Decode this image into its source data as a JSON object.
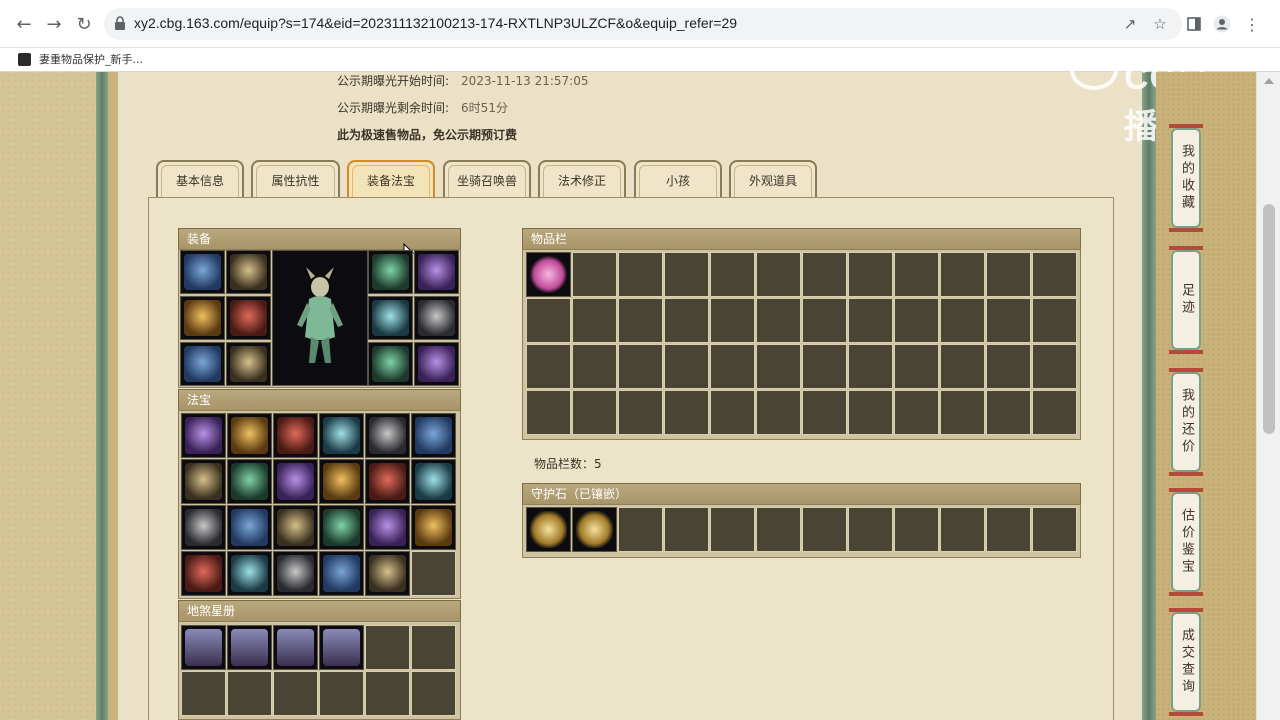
{
  "browser": {
    "url": "xy2.cbg.163.com/equip?s=174&eid=202311132100213-174-RXTLNP3ULZCF&o&equip_refer=29",
    "bookmark_label": "妻重物品保护_新手..."
  },
  "watermark": {
    "text": "CC直播"
  },
  "info": {
    "publicity_start_label": "公示期曝光开始时间:",
    "publicity_start_value": "2023-11-13 21:57:05",
    "publicity_remaining_label": "公示期曝光剩余时间:",
    "publicity_remaining_value": "6时51分",
    "notice": "此为极速售物品，免公示期预订费"
  },
  "tabs": [
    {
      "label": "基本信息"
    },
    {
      "label": "属性抗性"
    },
    {
      "label": "装备法宝",
      "active": true
    },
    {
      "label": "坐骑召唤兽"
    },
    {
      "label": "法术修正"
    },
    {
      "label": "小孩"
    },
    {
      "label": "外观道具"
    }
  ],
  "sections": {
    "equipment": "装备",
    "treasure": "法宝",
    "star_book": "地煞星册",
    "inventory": "物品栏",
    "guard_stone": "守护石（已镶嵌）"
  },
  "inventory_count_label": "物品栏数：5",
  "side_buttons": [
    {
      "label": "我的收藏"
    },
    {
      "label": "足迹"
    },
    {
      "label": "我的还价"
    },
    {
      "label": "估价鉴宝"
    },
    {
      "label": "成交查询"
    }
  ],
  "colors": {
    "accent_tab": "#d08a2a",
    "header_bar": "#a89568",
    "cell_empty": "#4a4434",
    "rail_green": "#5f7c66"
  }
}
